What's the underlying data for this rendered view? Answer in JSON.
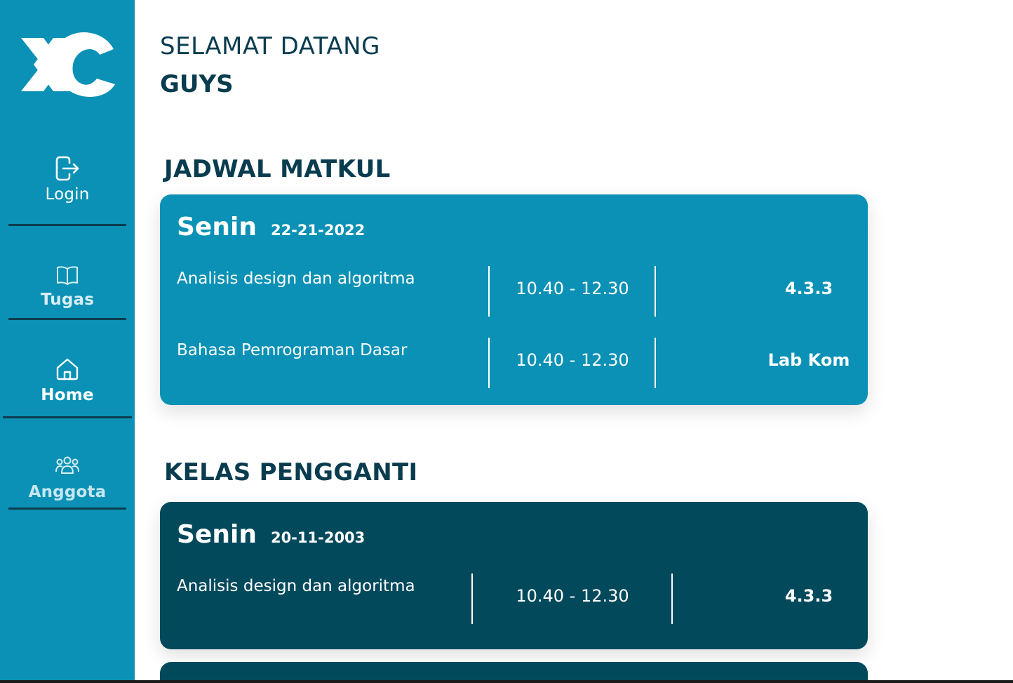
{
  "app": {
    "logo_name": "XC"
  },
  "sidebar": {
    "items": [
      {
        "label": "Login",
        "icon": "login-icon"
      },
      {
        "label": "Tugas",
        "icon": "book-icon"
      },
      {
        "label": "Home",
        "icon": "home-icon"
      },
      {
        "label": "Anggota",
        "icon": "users-icon"
      }
    ]
  },
  "greeting": {
    "line1": "SELAMAT DATANG",
    "line2": "GUYS"
  },
  "jadwal": {
    "title": "JADWAL MATKUL",
    "day": "Senin",
    "date": "22-21-2022",
    "rows": [
      {
        "course": "Analisis design dan algoritma",
        "time": "10.40 - 12.30",
        "room": "4.3.3"
      },
      {
        "course": "Bahasa Pemrograman Dasar",
        "time": "10.40 - 12.30",
        "room": "Lab Kom"
      }
    ]
  },
  "kelas": {
    "title": "KELAS PENGGANTI",
    "day": "Senin",
    "date": "20-11-2003",
    "rows": [
      {
        "course": "Analisis design dan algoritma",
        "time": "10.40 - 12.30",
        "room": "4.3.3"
      }
    ]
  },
  "colors": {
    "sidebar": "#0a91b5",
    "card_primary": "#0a91b5",
    "card_dark": "#03495c",
    "heading": "#0a3c4f"
  }
}
